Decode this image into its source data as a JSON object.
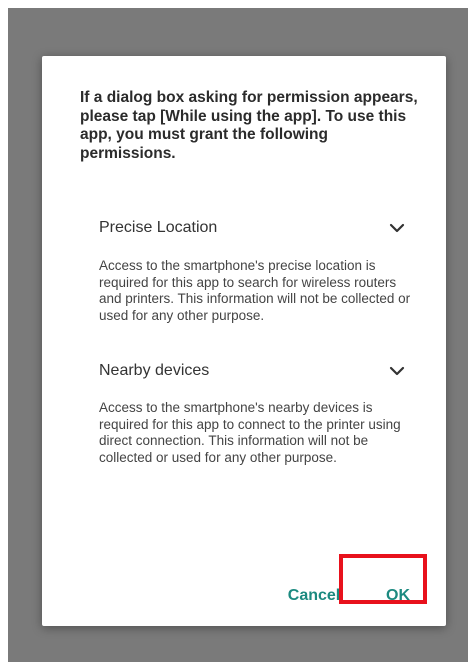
{
  "dialog": {
    "message": "If a dialog box asking for permission appears, please tap [While using the app]. To use this app, you must grant the following permissions.",
    "permissions": [
      {
        "title": "Precise Location",
        "description": "Access to the smartphone's precise location is required for this app to search for wireless routers and printers. This information will not be collected or used for any other purpose.",
        "icon": "chevron-down-icon"
      },
      {
        "title": "Nearby devices",
        "description": "Access to the smartphone's nearby devices is required for this app to connect to the printer using direct connection. This information will not be collected or used for any other purpose.",
        "icon": "chevron-down-icon"
      }
    ],
    "cancel_label": "Cancel",
    "ok_label": "OK"
  },
  "colors": {
    "backdrop": "#7a7a7a",
    "accent": "#1c8a80",
    "highlight": "#e8111c"
  }
}
